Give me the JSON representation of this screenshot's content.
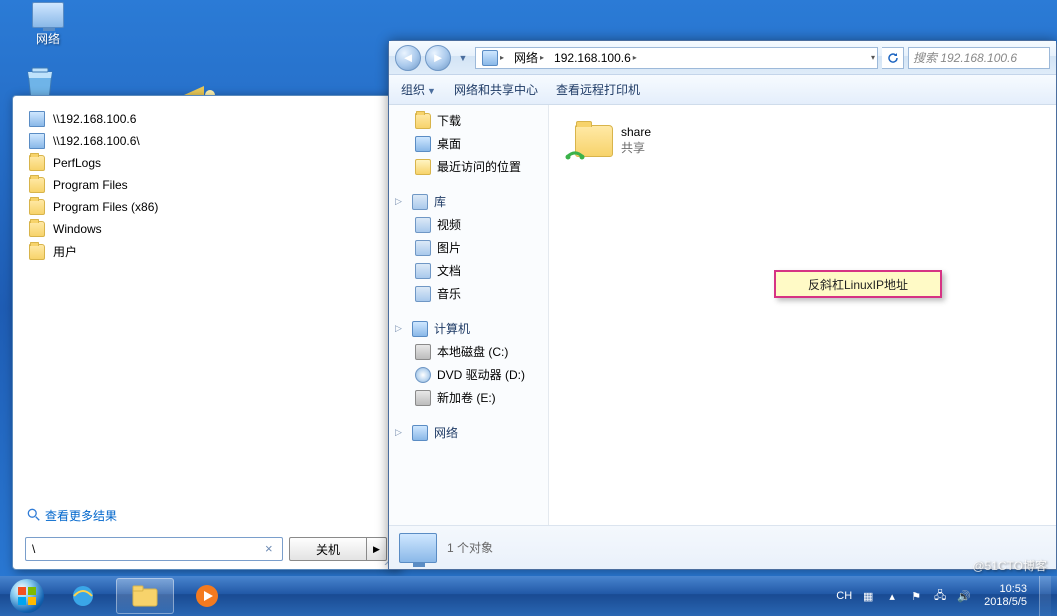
{
  "desktop": {
    "network_label": "网络"
  },
  "start_menu": {
    "items": [
      {
        "kind": "computer",
        "label": "\\\\192.168.100.6"
      },
      {
        "kind": "computer",
        "label": "\\\\192.168.100.6\\"
      },
      {
        "kind": "folder",
        "label": "PerfLogs"
      },
      {
        "kind": "folder",
        "label": "Program Files"
      },
      {
        "kind": "folder",
        "label": "Program Files (x86)"
      },
      {
        "kind": "folder",
        "label": "Windows"
      },
      {
        "kind": "folder",
        "label": "用户"
      }
    ],
    "see_more": "查看更多结果",
    "search_value": "\\",
    "shutdown_label": "关机"
  },
  "explorer": {
    "breadcrumb": {
      "root": "网络",
      "node": "192.168.100.6"
    },
    "search_placeholder": "搜索 192.168.100.6",
    "toolbar": {
      "organize": "组织",
      "sharing_center": "网络和共享中心",
      "remote_printers": "查看远程打印机"
    },
    "nav": {
      "downloads": "下载",
      "desktop": "桌面",
      "recent": "最近访问的位置",
      "libraries": "库",
      "videos": "视频",
      "pictures": "图片",
      "documents": "文档",
      "music": "音乐",
      "computer": "计算机",
      "local_c": "本地磁盘 (C:)",
      "dvd_d": "DVD 驱动器 (D:)",
      "vol_e": "新加卷 (E:)",
      "network": "网络"
    },
    "content": {
      "share_name": "share",
      "share_sub": "共享"
    },
    "annotation": "反斜杠LinuxIP地址",
    "status": "1 个对象"
  },
  "taskbar": {
    "ime": "CH",
    "clock_time": "10:53",
    "clock_date": "2018/5/5"
  },
  "watermark": "@51CTO博客"
}
